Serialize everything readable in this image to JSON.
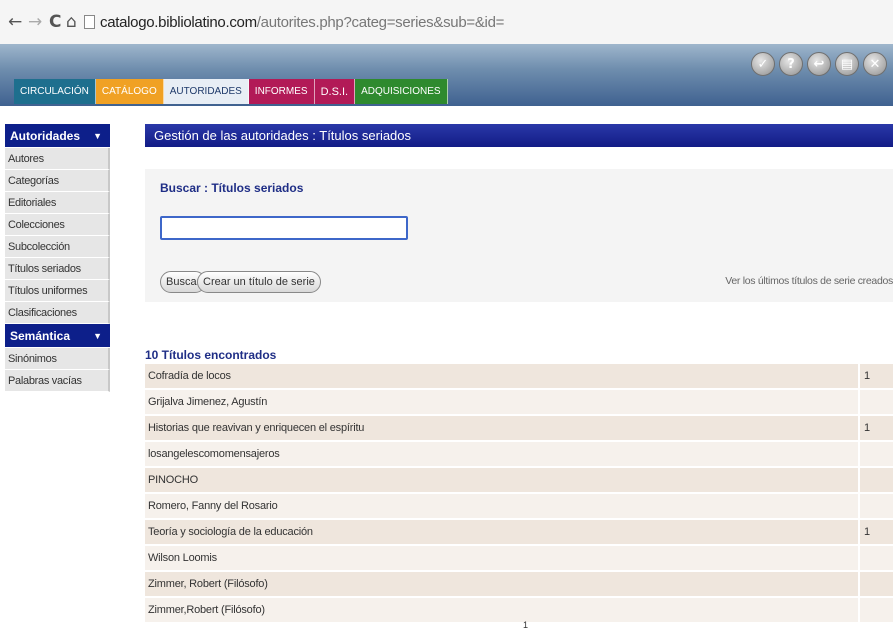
{
  "browser": {
    "url_domain": "catalogo.bibliolatino.com",
    "url_rest": "/autorites.php?categ=series&sub=&id=",
    "back": "←",
    "forward": "→",
    "reload": "C",
    "home": "⌂"
  },
  "tabs": [
    "Circulación",
    "Catálogo",
    "Autoridades",
    "Informes",
    "D.S.I.",
    "Adquisiciones"
  ],
  "header_icons": [
    "✓",
    "?",
    "↩",
    "▤",
    "✕"
  ],
  "sidebar": {
    "section1": "Autoridades",
    "items1": [
      "Autores",
      "Categorías",
      "Editoriales",
      "Colecciones",
      "Subcolección",
      "Títulos seriados",
      "Títulos uniformes",
      "Clasificaciones"
    ],
    "section2": "Semántica",
    "items2": [
      "Sinónimos",
      "Palabras vacías"
    ],
    "arrow": "▼"
  },
  "main": {
    "title": "Gestión de las autoridades : Títulos seriados",
    "search_title": "Buscar : Títulos seriados",
    "search_value": "",
    "buscar_button": "Buscar",
    "crear_button": "Crear un título de serie",
    "last_link": "Ver los últimos títulos de serie creados",
    "found": "10 Títulos encontrados",
    "results": [
      {
        "name": "Cofradía de locos",
        "count": "1"
      },
      {
        "name": "Grijalva Jimenez, Agustín",
        "count": ""
      },
      {
        "name": "Historias que reavivan y enriquecen el espíritu",
        "count": "1"
      },
      {
        "name": "losangelescomomensajeros",
        "count": ""
      },
      {
        "name": "PINOCHO",
        "count": ""
      },
      {
        "name": "Romero, Fanny del Rosario",
        "count": ""
      },
      {
        "name": "Teoría y sociología de la educación",
        "count": "1"
      },
      {
        "name": "Wilson Loomis",
        "count": ""
      },
      {
        "name": "Zimmer, Robert (Filósofo)",
        "count": ""
      },
      {
        "name": "Zimmer,Robert (Filósofo)",
        "count": ""
      }
    ],
    "pager": "1"
  }
}
